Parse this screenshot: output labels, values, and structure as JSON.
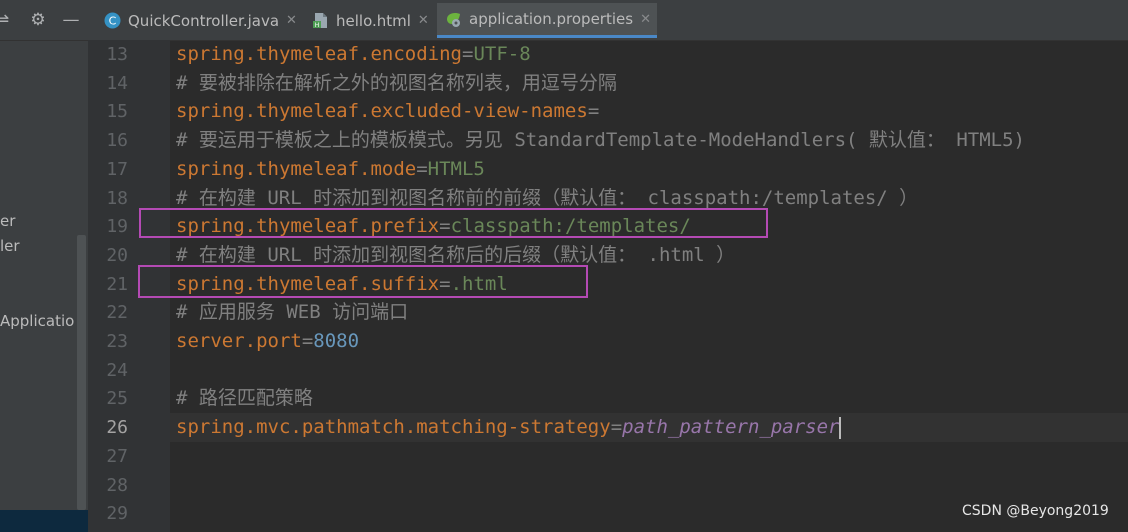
{
  "tabs": [
    {
      "label": "QuickController.java",
      "icon": "java-class-icon",
      "active": false
    },
    {
      "label": "hello.html",
      "icon": "html-file-icon",
      "active": false
    },
    {
      "label": "application.properties",
      "icon": "spring-properties-icon",
      "active": true
    }
  ],
  "sidebar": {
    "fragments": [
      "er",
      "ler",
      "Applicatio"
    ]
  },
  "editor": {
    "lines": [
      {
        "no": "13",
        "key": "spring.thymeleaf.encoding",
        "eq": "=",
        "value": "UTF-8",
        "vtype": "val"
      },
      {
        "no": "14",
        "comment": "# 要被排除在解析之外的视图名称列表，用逗号分隔"
      },
      {
        "no": "15",
        "key": "spring.thymeleaf.excluded-view-names",
        "eq": "=",
        "value": "",
        "vtype": "val"
      },
      {
        "no": "16",
        "comment": "# 要运用于模板之上的模板模式。另见 StandardTemplate-ModeHandlers( 默认值： HTML5)"
      },
      {
        "no": "17",
        "key": "spring.thymeleaf.mode",
        "eq": "=",
        "value": "HTML5",
        "vtype": "val"
      },
      {
        "no": "18",
        "comment": "# 在构建 URL 时添加到视图名称前的前缀（默认值： classpath:/templates/ ）"
      },
      {
        "no": "19",
        "key": "spring.thymeleaf.prefix",
        "eq": "=",
        "value": "classpath:/templates/",
        "vtype": "val"
      },
      {
        "no": "20",
        "comment": "# 在构建 URL 时添加到视图名称后的后缀（默认值： .html ）"
      },
      {
        "no": "21",
        "key": "spring.thymeleaf.suffix",
        "eq": "=",
        "value": ".html",
        "vtype": "val"
      },
      {
        "no": "22",
        "comment": "# 应用服务 WEB 访问端口"
      },
      {
        "no": "23",
        "key": "server.port",
        "eq": "=",
        "value": "8080",
        "vtype": "num"
      },
      {
        "no": "24"
      },
      {
        "no": "25",
        "comment": "# 路径匹配策略"
      },
      {
        "no": "26",
        "key": "spring.mvc.pathmatch.matching-strategy",
        "eq": "=",
        "value": "path_pattern_parser",
        "vtype": "enum",
        "current": true
      },
      {
        "no": "27"
      },
      {
        "no": "28"
      },
      {
        "no": "29"
      }
    ]
  },
  "watermark": "CSDN @Beyong2019",
  "colors": {
    "key": "#cc7832",
    "value": "#6a8759",
    "number": "#6897bb",
    "enum": "#9876aa",
    "comment": "#808080",
    "highlight_box": "#b44ab4",
    "active_tab_underline": "#4a88c7"
  }
}
